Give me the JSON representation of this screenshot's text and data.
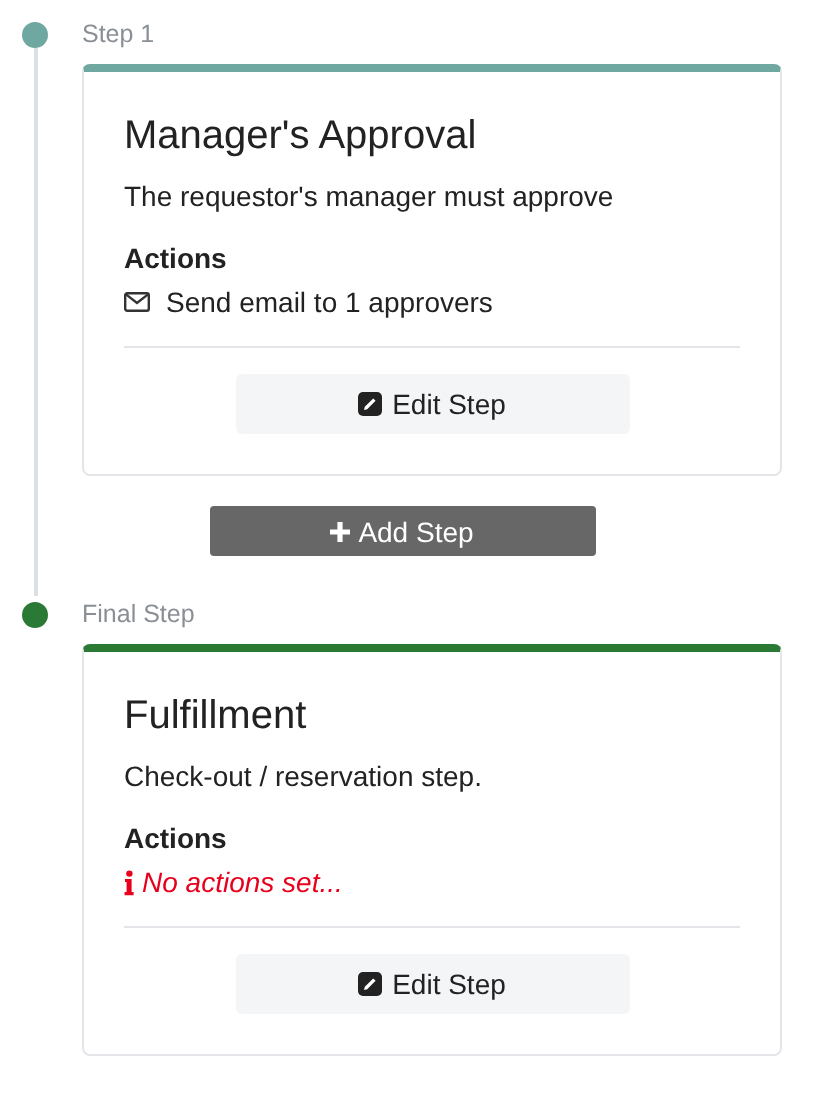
{
  "steps": [
    {
      "label": "Step 1",
      "color": "#6fa8a0",
      "title": "Manager's Approval",
      "description": "The requestor's manager must approve",
      "actions_heading": "Actions",
      "actions": [
        {
          "kind": "email",
          "text": "Send email to 1 approvers"
        }
      ],
      "edit_button": "Edit Step"
    },
    {
      "label": "Final Step",
      "color": "#2a7a35",
      "title": "Fulfillment",
      "description": "Check-out / reservation step.",
      "actions_heading": "Actions",
      "actions": [
        {
          "kind": "empty",
          "text": "No actions set..."
        }
      ],
      "edit_button": "Edit Step"
    }
  ],
  "add_step_button": "Add Step"
}
